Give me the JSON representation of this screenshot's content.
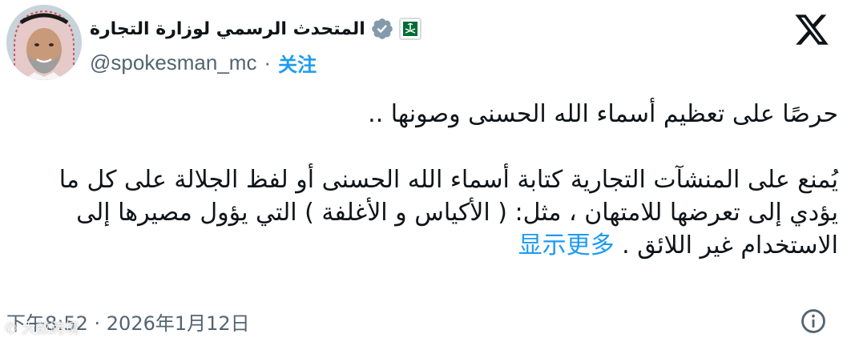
{
  "author": {
    "display_name": "المتحدث الرسمي لوزارة التجارة",
    "handle": "@spokesman_mc",
    "separator": "·",
    "follow_label": "关注",
    "verified_icon": "verified-badge-icon",
    "affiliate_icon": "saudi-emblem-icon"
  },
  "tweet": {
    "lines": [
      "حرصًا على تعظيم أسماء الله الحسنى وصونها ..",
      "يُمنع على المنشآت التجارية كتابة أسماء الله الحسنى أو لفظ الجلالة على كل ما",
      "يؤدي إلى تعرضها للامتهان ، مثل: ( الأكياس و الأغلفة ) التي يؤول مصيرها إلى",
      "الاستخدام غير اللائق ."
    ],
    "show_more_label": "显示更多"
  },
  "footer": {
    "timestamp": "下午8:52 · 2026年1月12日"
  },
  "watermark": "大数跨境",
  "colors": {
    "accent": "#1d9bf0",
    "text": "#0f1419",
    "muted": "#536471",
    "verified_gray": "#829aab",
    "emblem_green": "#006c35"
  }
}
